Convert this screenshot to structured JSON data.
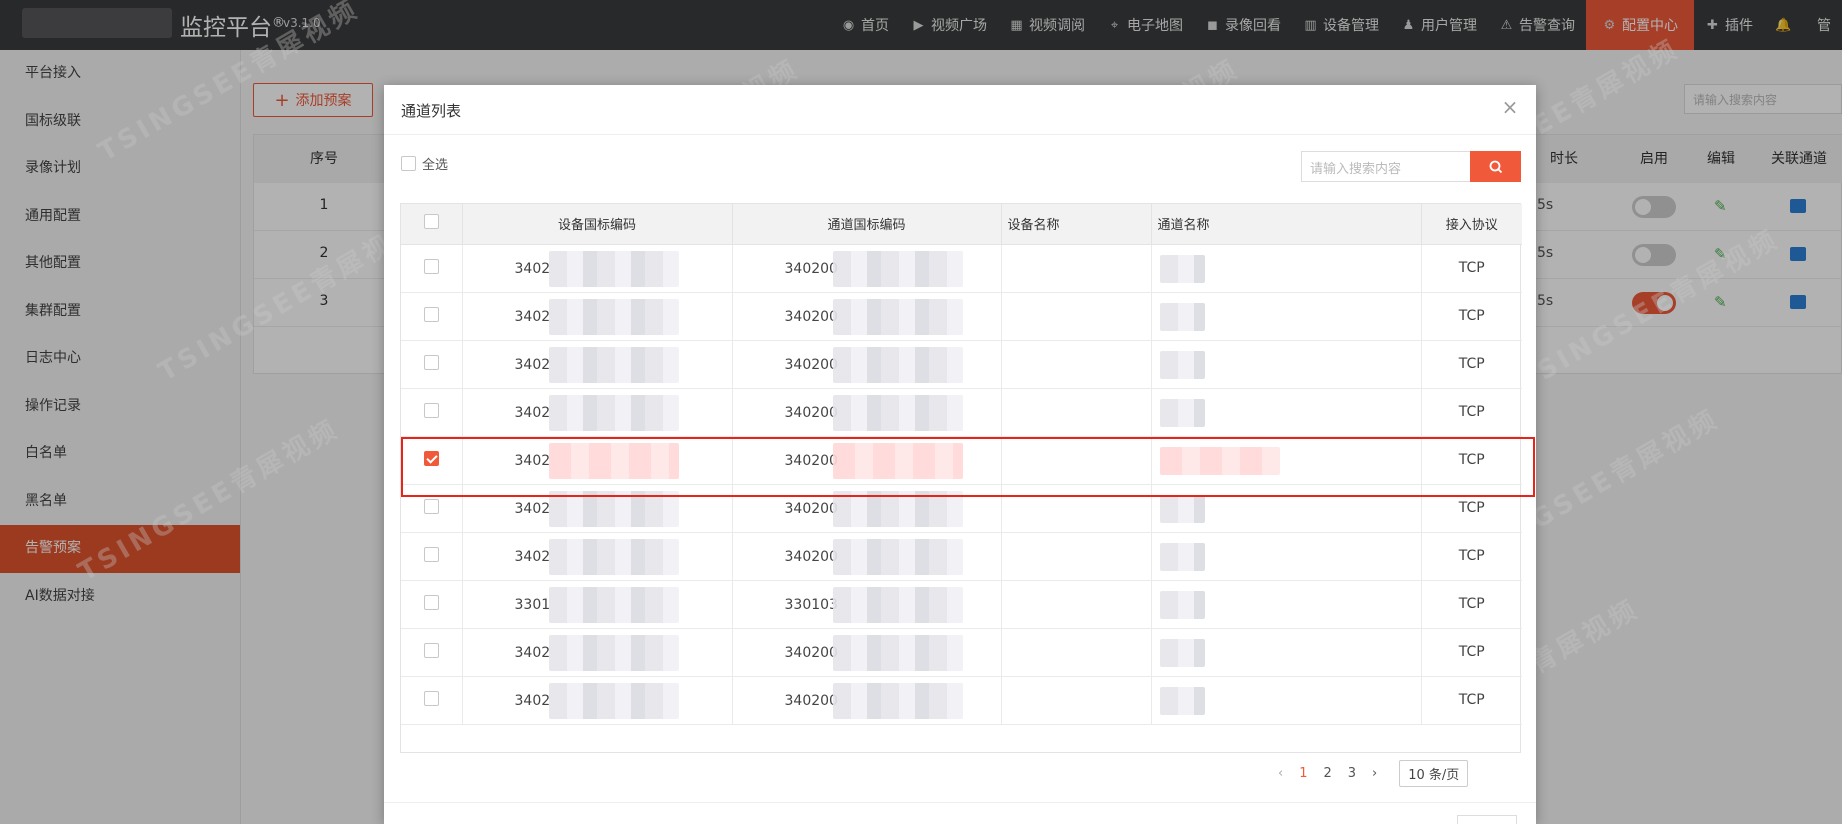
{
  "app": {
    "title": "监控平台",
    "trademark": "®",
    "version": "v3.1.0"
  },
  "nav": [
    {
      "icon": "dashboard-icon",
      "label": "首页",
      "active": false
    },
    {
      "icon": "play-circle-icon",
      "label": "视频广场",
      "active": false
    },
    {
      "icon": "grid-icon",
      "label": "视频调阅",
      "active": false
    },
    {
      "icon": "map-pin-icon",
      "label": "电子地图",
      "active": false
    },
    {
      "icon": "camera-icon",
      "label": "录像回看",
      "active": false
    },
    {
      "icon": "device-icon",
      "label": "设备管理",
      "active": false
    },
    {
      "icon": "user-icon",
      "label": "用户管理",
      "active": false
    },
    {
      "icon": "alarm-icon",
      "label": "告警查询",
      "active": false
    },
    {
      "icon": "gear-icon",
      "label": "配置中心",
      "active": true
    },
    {
      "icon": "puzzle-icon",
      "label": "插件",
      "active": false
    },
    {
      "icon": "bell-icon",
      "label": "",
      "active": false
    },
    {
      "icon": "",
      "label": "管",
      "active": false
    }
  ],
  "sidebar": [
    {
      "label": "平台接入",
      "active": false
    },
    {
      "label": "国标级联",
      "active": false
    },
    {
      "label": "录像计划",
      "active": false
    },
    {
      "label": "通用配置",
      "active": false
    },
    {
      "label": "其他配置",
      "active": false
    },
    {
      "label": "集群配置",
      "active": false
    },
    {
      "label": "日志中心",
      "active": false
    },
    {
      "label": "操作记录",
      "active": false
    },
    {
      "label": "白名单",
      "active": false
    },
    {
      "label": "黑名单",
      "active": false
    },
    {
      "label": "告警预案",
      "active": true
    },
    {
      "label": "AI数据对接",
      "active": false
    }
  ],
  "background": {
    "add_button_label": "添加预案",
    "search_placeholder": "请输入搜索内容",
    "headers": {
      "index": "序号",
      "duration": "时长",
      "enabled": "启用",
      "edit": "编辑",
      "link_channel": "关联通道"
    },
    "rows": [
      {
        "index": "1",
        "duration_tail": "5s",
        "enabled": false
      },
      {
        "index": "2",
        "duration_tail": "5s",
        "enabled": false
      },
      {
        "index": "3",
        "duration_tail": "5s",
        "enabled": true
      }
    ]
  },
  "modal": {
    "title": "通道列表",
    "select_all_label": "全选",
    "search_placeholder": "请输入搜索内容",
    "columns": {
      "device_code": "设备国标编码",
      "channel_code": "通道国标编码",
      "device_name": "设备名称",
      "channel_name": "通道名称",
      "protocol": "接入协议"
    },
    "rows": [
      {
        "checked": false,
        "device_code": "3402",
        "channel_code": "340200",
        "protocol": "TCP"
      },
      {
        "checked": false,
        "device_code": "3402",
        "channel_code": "340200",
        "protocol": "TCP"
      },
      {
        "checked": false,
        "device_code": "3402",
        "channel_code": "340200",
        "protocol": "TCP"
      },
      {
        "checked": false,
        "device_code": "3402",
        "channel_code": "340200",
        "protocol": "TCP"
      },
      {
        "checked": true,
        "device_code": "3402",
        "channel_code": "340200",
        "protocol": "TCP"
      },
      {
        "checked": false,
        "device_code": "3402",
        "channel_code": "340200",
        "protocol": "TCP"
      },
      {
        "checked": false,
        "device_code": "3402",
        "channel_code": "340200",
        "protocol": "TCP"
      },
      {
        "checked": false,
        "device_code": "3301",
        "channel_code": "330103",
        "protocol": "TCP"
      },
      {
        "checked": false,
        "device_code": "3402",
        "channel_code": "340200",
        "protocol": "TCP"
      },
      {
        "checked": false,
        "device_code": "3402",
        "channel_code": "340200",
        "protocol": "TCP"
      }
    ],
    "pagination": {
      "prev": "‹",
      "pages": [
        "1",
        "2",
        "3"
      ],
      "current": "1",
      "next": "›",
      "page_size": "10 条/页"
    }
  },
  "watermark": "TSINGSEE青犀视频",
  "colors": {
    "accent": "#f05a3a",
    "topbar": "#3a3b3d",
    "highlight": "#e8241a"
  }
}
